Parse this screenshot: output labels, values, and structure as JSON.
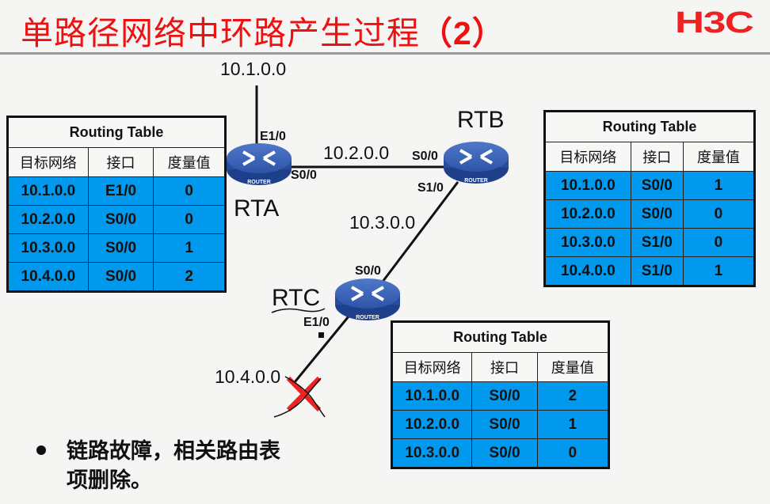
{
  "slide": {
    "title": "单路径网络中环路产生过程",
    "title_number": "（2）",
    "logo": "H3C",
    "accent_color": "#ee1111",
    "table_fill_color": "#0099ee"
  },
  "topology": {
    "routers": [
      {
        "name": "RTA",
        "icon": "router-icon",
        "badge": "ROUTER"
      },
      {
        "name": "RTB",
        "icon": "router-icon",
        "badge": "ROUTER"
      },
      {
        "name": "RTC",
        "icon": "router-icon",
        "badge": "ROUTER"
      }
    ],
    "networks": [
      "10.1.0.0",
      "10.2.0.0",
      "10.3.0.0",
      "10.4.0.0"
    ],
    "interfaces": {
      "rta_e1": "E1/0",
      "rta_s0": "S0/0",
      "rtb_s0": "S0/0",
      "rtb_s1": "S1/0",
      "rtc_s0": "S0/0",
      "rtc_e1": "E1/0"
    },
    "failure_marker": "link-failure-x-icon"
  },
  "tables": {
    "rta": {
      "caption": "Routing Table",
      "headers": [
        "目标网络",
        "接口",
        "度量值"
      ],
      "rows": [
        [
          "10.1.0.0",
          "E1/0",
          "0"
        ],
        [
          "10.2.0.0",
          "S0/0",
          "0"
        ],
        [
          "10.3.0.0",
          "S0/0",
          "1"
        ],
        [
          "10.4.0.0",
          "S0/0",
          "2"
        ]
      ]
    },
    "rtb": {
      "caption": "Routing Table",
      "headers": [
        "目标网络",
        "接口",
        "度量值"
      ],
      "rows": [
        [
          "10.1.0.0",
          "S0/0",
          "1"
        ],
        [
          "10.2.0.0",
          "S0/0",
          "0"
        ],
        [
          "10.3.0.0",
          "S1/0",
          "0"
        ],
        [
          "10.4.0.0",
          "S1/0",
          "1"
        ]
      ]
    },
    "rtc": {
      "caption": "Routing Table",
      "headers": [
        "目标网络",
        "接口",
        "度量值"
      ],
      "rows": [
        [
          "10.1.0.0",
          "S0/0",
          "2"
        ],
        [
          "10.2.0.0",
          "S0/0",
          "1"
        ],
        [
          "10.3.0.0",
          "S0/0",
          "0"
        ]
      ]
    }
  },
  "bullet": {
    "text": "链路故障，相关路由表项删除。"
  }
}
